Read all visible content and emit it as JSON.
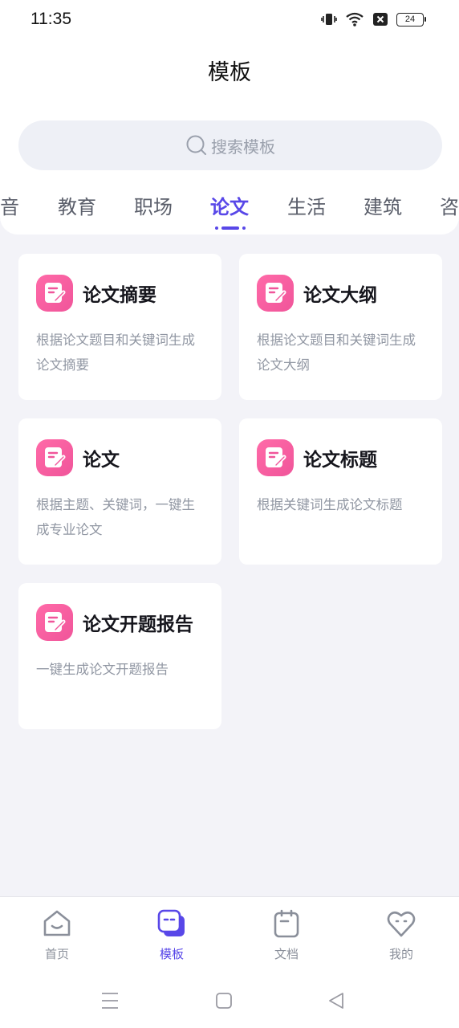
{
  "status_bar": {
    "time": "11:35",
    "battery": "24"
  },
  "header": {
    "title": "模板"
  },
  "search": {
    "placeholder": "搜索模板"
  },
  "tabs": [
    {
      "label": "音"
    },
    {
      "label": "教育"
    },
    {
      "label": "职场"
    },
    {
      "label": "论文",
      "active": true
    },
    {
      "label": "生活"
    },
    {
      "label": "建筑"
    },
    {
      "label": "咨"
    }
  ],
  "cards": [
    {
      "title": "论文摘要",
      "desc": "根据论文题目和关键词生成论文摘要"
    },
    {
      "title": "论文大纲",
      "desc": "根据论文题目和关键词生成论文大纲"
    },
    {
      "title": "论文",
      "desc": "根据主题、关键词，一键生成专业论文"
    },
    {
      "title": "论文标题",
      "desc": "根据关键词生成论文标题"
    },
    {
      "title": "论文开题报告",
      "desc": "一键生成论文开题报告"
    }
  ],
  "bottom_nav": [
    {
      "label": "首页",
      "icon": "home-icon"
    },
    {
      "label": "模板",
      "icon": "template-icon",
      "active": true
    },
    {
      "label": "文档",
      "icon": "document-icon"
    },
    {
      "label": "我的",
      "icon": "profile-heart-icon"
    }
  ],
  "colors": {
    "accent": "#5847e8",
    "card_icon": "#f0559a",
    "background": "#f3f3f8"
  }
}
